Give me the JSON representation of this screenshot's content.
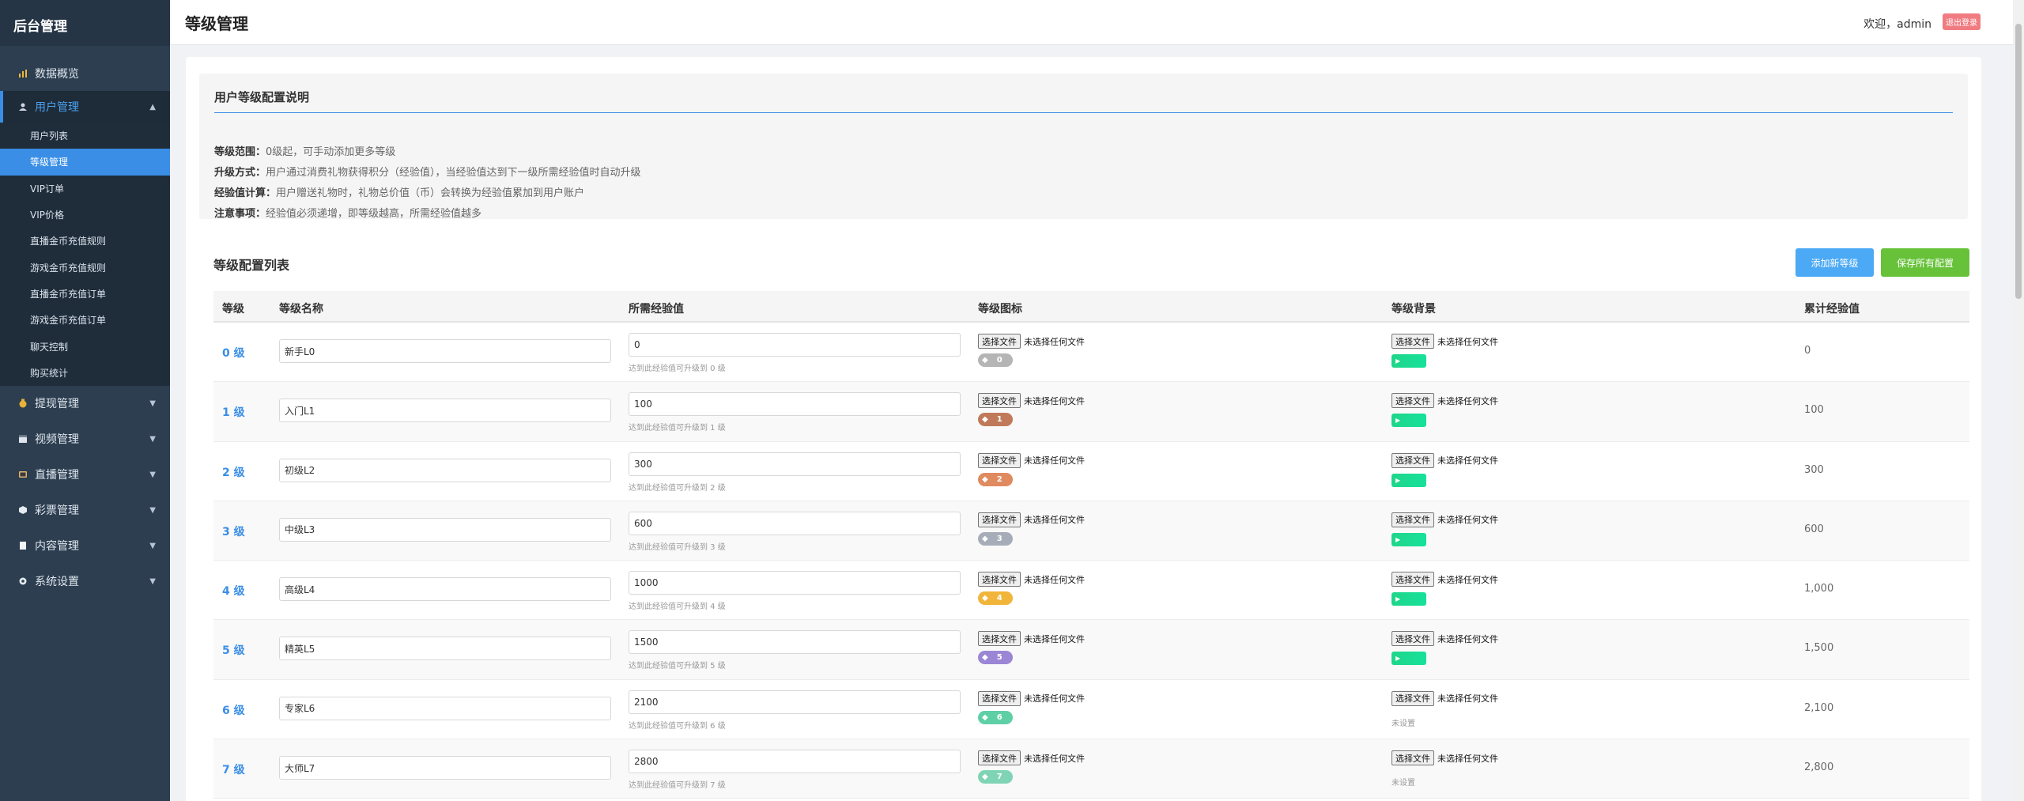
{
  "sidebar": {
    "brand": "后台管理",
    "items": [
      {
        "label": "数据概览",
        "icon": "chart-icon",
        "color": "#f0b83b"
      },
      {
        "label": "用户管理",
        "icon": "user-icon",
        "expanded": true,
        "children": [
          {
            "label": "用户列表"
          },
          {
            "label": "等级管理",
            "active": true
          },
          {
            "label": "VIP订单"
          },
          {
            "label": "VIP价格"
          },
          {
            "label": "直播金币充值规则"
          },
          {
            "label": "游戏金币充值规则"
          },
          {
            "label": "直播金币充值订单"
          },
          {
            "label": "游戏金币充值订单"
          },
          {
            "label": "聊天控制"
          },
          {
            "label": "购买统计"
          }
        ]
      },
      {
        "label": "提现管理",
        "icon": "money-bag-icon"
      },
      {
        "label": "视频管理",
        "icon": "clapperboard-icon"
      },
      {
        "label": "直播管理",
        "icon": "tv-icon"
      },
      {
        "label": "彩票管理",
        "icon": "cube-icon"
      },
      {
        "label": "内容管理",
        "icon": "document-icon"
      },
      {
        "label": "系统设置",
        "icon": "gear-icon"
      }
    ]
  },
  "header": {
    "title": "等级管理",
    "welcome": "欢迎，admin",
    "logout": "退出登录"
  },
  "info": {
    "title": "用户等级配置说明",
    "lines": [
      {
        "label": "等级范围：",
        "text": "0级起，可手动添加更多等级"
      },
      {
        "label": "升级方式：",
        "text": "用户通过消费礼物获得积分（经验值），当经验值达到下一级所需经验值时自动升级"
      },
      {
        "label": "经验值计算：",
        "text": "用户赠送礼物时，礼物总价值（币）会转换为经验值累加到用户账户"
      },
      {
        "label": "注意事项：",
        "text": "经验值必须递增，即等级越高，所需经验值越多"
      }
    ]
  },
  "list": {
    "title": "等级配置列表",
    "add_button": "添加新等级",
    "save_button": "保存所有配置",
    "headers": [
      "等级",
      "等级名称",
      "所需经验值",
      "等级图标",
      "等级背景",
      "累计经验值"
    ],
    "file_button": "选择文件",
    "file_none": "未选择任何文件",
    "unset_text": "未设置",
    "rows": [
      {
        "level": "0 级",
        "name": "新手L0",
        "exp": "0",
        "hint": "达到此经验值可升级到 0 级",
        "badge_num": "0",
        "badge_color": "#b5b5b5",
        "bg_set": true,
        "total": "0"
      },
      {
        "level": "1 级",
        "name": "入门L1",
        "exp": "100",
        "hint": "达到此经验值可升级到 1 级",
        "badge_num": "1",
        "badge_color": "#c07a5a",
        "bg_set": true,
        "total": "100"
      },
      {
        "level": "2 级",
        "name": "初级L2",
        "exp": "300",
        "hint": "达到此经验值可升级到 2 级",
        "badge_num": "2",
        "badge_color": "#e08a60",
        "bg_set": true,
        "total": "300"
      },
      {
        "level": "3 级",
        "name": "中级L3",
        "exp": "600",
        "hint": "达到此经验值可升级到 3 级",
        "badge_num": "3",
        "badge_color": "#a6adb8",
        "bg_set": true,
        "total": "600"
      },
      {
        "level": "4 级",
        "name": "高级L4",
        "exp": "1000",
        "hint": "达到此经验值可升级到 4 级",
        "badge_num": "4",
        "badge_color": "#f0b53a",
        "bg_set": true,
        "total": "1,000"
      },
      {
        "level": "5 级",
        "name": "精英L5",
        "exp": "1500",
        "hint": "达到此经验值可升级到 5 级",
        "badge_num": "5",
        "badge_color": "#9b86d6",
        "bg_set": true,
        "total": "1,500"
      },
      {
        "level": "6 级",
        "name": "专家L6",
        "exp": "2100",
        "hint": "达到此经验值可升级到 6 级",
        "badge_num": "6",
        "badge_color": "#5fcfa6",
        "bg_set": false,
        "total": "2,100"
      },
      {
        "level": "7 级",
        "name": "大师L7",
        "exp": "2800",
        "hint": "达到此经验值可升级到 7 级",
        "badge_num": "7",
        "badge_color": "#7fd4b5",
        "bg_set": false,
        "total": "2,800"
      }
    ]
  }
}
